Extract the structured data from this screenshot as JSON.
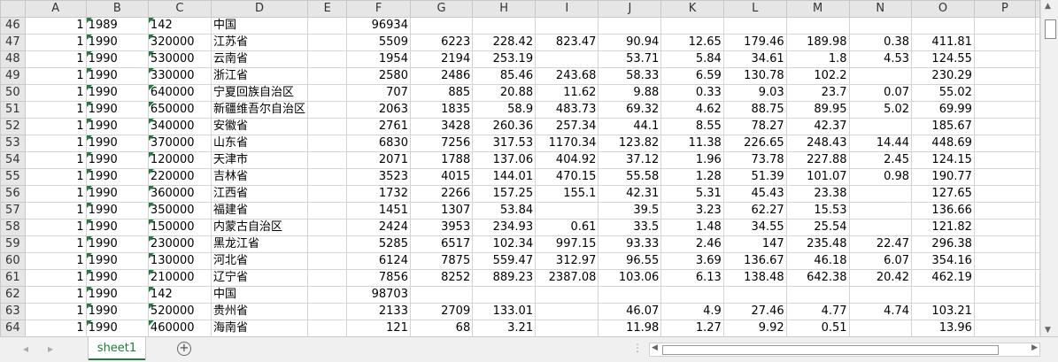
{
  "columns": [
    "A",
    "B",
    "C",
    "D",
    "E",
    "F",
    "G",
    "H",
    "I",
    "J",
    "K",
    "L",
    "M",
    "N",
    "O",
    "P"
  ],
  "rows": [
    {
      "n": "46",
      "A": "1",
      "B": "1989",
      "C": "142",
      "D": "中国",
      "E": "",
      "F": "96934",
      "G": "",
      "H": "",
      "I": "",
      "J": "",
      "K": "",
      "L": "",
      "M": "",
      "N": "",
      "O": "",
      "P": ""
    },
    {
      "n": "47",
      "A": "1",
      "B": "1990",
      "C": "320000",
      "D": "江苏省",
      "E": "",
      "F": "5509",
      "G": "6223",
      "H": "228.42",
      "I": "823.47",
      "J": "90.94",
      "K": "12.65",
      "L": "179.46",
      "M": "189.98",
      "N": "0.38",
      "O": "411.81",
      "P": ""
    },
    {
      "n": "48",
      "A": "1",
      "B": "1990",
      "C": "530000",
      "D": "云南省",
      "E": "",
      "F": "1954",
      "G": "2194",
      "H": "253.19",
      "I": "",
      "J": "53.71",
      "K": "5.84",
      "L": "34.61",
      "M": "1.8",
      "N": "4.53",
      "O": "124.55",
      "P": ""
    },
    {
      "n": "49",
      "A": "1",
      "B": "1990",
      "C": "330000",
      "D": "浙江省",
      "E": "",
      "F": "2580",
      "G": "2486",
      "H": "85.46",
      "I": "243.68",
      "J": "58.33",
      "K": "6.59",
      "L": "130.78",
      "M": "102.2",
      "N": "",
      "O": "230.29",
      "P": ""
    },
    {
      "n": "50",
      "A": "1",
      "B": "1990",
      "C": "640000",
      "D": "宁夏回族自治区",
      "E": "",
      "F": "707",
      "G": "885",
      "H": "20.88",
      "I": "11.62",
      "J": "9.88",
      "K": "0.33",
      "L": "9.03",
      "M": "23.7",
      "N": "0.07",
      "O": "55.02",
      "P": ""
    },
    {
      "n": "51",
      "A": "1",
      "B": "1990",
      "C": "650000",
      "D": "新疆维吾尔自治区",
      "E": "",
      "F": "2063",
      "G": "1835",
      "H": "58.9",
      "I": "483.73",
      "J": "69.32",
      "K": "4.62",
      "L": "88.75",
      "M": "89.95",
      "N": "5.02",
      "O": "69.99",
      "P": ""
    },
    {
      "n": "52",
      "A": "1",
      "B": "1990",
      "C": "340000",
      "D": "安徽省",
      "E": "",
      "F": "2761",
      "G": "3428",
      "H": "260.36",
      "I": "257.34",
      "J": "44.1",
      "K": "8.55",
      "L": "78.27",
      "M": "42.37",
      "N": "",
      "O": "185.67",
      "P": ""
    },
    {
      "n": "53",
      "A": "1",
      "B": "1990",
      "C": "370000",
      "D": "山东省",
      "E": "",
      "F": "6830",
      "G": "7256",
      "H": "317.53",
      "I": "1170.34",
      "J": "123.82",
      "K": "11.38",
      "L": "226.65",
      "M": "248.43",
      "N": "14.44",
      "O": "448.69",
      "P": ""
    },
    {
      "n": "54",
      "A": "1",
      "B": "1990",
      "C": "120000",
      "D": "天津市",
      "E": "",
      "F": "2071",
      "G": "1788",
      "H": "137.06",
      "I": "404.92",
      "J": "37.12",
      "K": "1.96",
      "L": "73.78",
      "M": "227.88",
      "N": "2.45",
      "O": "124.15",
      "P": ""
    },
    {
      "n": "55",
      "A": "1",
      "B": "1990",
      "C": "220000",
      "D": "吉林省",
      "E": "",
      "F": "3523",
      "G": "4015",
      "H": "144.01",
      "I": "470.15",
      "J": "55.58",
      "K": "1.28",
      "L": "51.39",
      "M": "101.07",
      "N": "0.98",
      "O": "190.77",
      "P": ""
    },
    {
      "n": "56",
      "A": "1",
      "B": "1990",
      "C": "360000",
      "D": "江西省",
      "E": "",
      "F": "1732",
      "G": "2266",
      "H": "157.25",
      "I": "155.1",
      "J": "42.31",
      "K": "5.31",
      "L": "45.43",
      "M": "23.38",
      "N": "",
      "O": "127.65",
      "P": ""
    },
    {
      "n": "57",
      "A": "1",
      "B": "1990",
      "C": "350000",
      "D": "福建省",
      "E": "",
      "F": "1451",
      "G": "1307",
      "H": "53.84",
      "I": "",
      "J": "39.5",
      "K": "3.23",
      "L": "62.27",
      "M": "15.53",
      "N": "",
      "O": "136.66",
      "P": ""
    },
    {
      "n": "58",
      "A": "1",
      "B": "1990",
      "C": "150000",
      "D": "内蒙古自治区",
      "E": "",
      "F": "2424",
      "G": "3953",
      "H": "234.93",
      "I": "0.61",
      "J": "33.5",
      "K": "1.48",
      "L": "34.55",
      "M": "25.54",
      "N": "",
      "O": "121.82",
      "P": ""
    },
    {
      "n": "59",
      "A": "1",
      "B": "1990",
      "C": "230000",
      "D": "黑龙江省",
      "E": "",
      "F": "5285",
      "G": "6517",
      "H": "102.34",
      "I": "997.15",
      "J": "93.33",
      "K": "2.46",
      "L": "147",
      "M": "235.48",
      "N": "22.47",
      "O": "296.38",
      "P": ""
    },
    {
      "n": "60",
      "A": "1",
      "B": "1990",
      "C": "130000",
      "D": "河北省",
      "E": "",
      "F": "6124",
      "G": "7875",
      "H": "559.47",
      "I": "312.97",
      "J": "96.55",
      "K": "3.69",
      "L": "136.67",
      "M": "46.18",
      "N": "6.07",
      "O": "354.16",
      "P": ""
    },
    {
      "n": "61",
      "A": "1",
      "B": "1990",
      "C": "210000",
      "D": "辽宁省",
      "E": "",
      "F": "7856",
      "G": "8252",
      "H": "889.23",
      "I": "2387.08",
      "J": "103.06",
      "K": "6.13",
      "L": "138.48",
      "M": "642.38",
      "N": "20.42",
      "O": "462.19",
      "P": ""
    },
    {
      "n": "62",
      "A": "1",
      "B": "1990",
      "C": "142",
      "D": "中国",
      "E": "",
      "F": "98703",
      "G": "",
      "H": "",
      "I": "",
      "J": "",
      "K": "",
      "L": "",
      "M": "",
      "N": "",
      "O": "",
      "P": ""
    },
    {
      "n": "63",
      "A": "1",
      "B": "1990",
      "C": "520000",
      "D": "贵州省",
      "E": "",
      "F": "2133",
      "G": "2709",
      "H": "133.01",
      "I": "",
      "J": "46.07",
      "K": "4.9",
      "L": "27.46",
      "M": "4.77",
      "N": "4.74",
      "O": "103.21",
      "P": ""
    },
    {
      "n": "64",
      "A": "1",
      "B": "1990",
      "C": "460000",
      "D": "海南省",
      "E": "",
      "F": "121",
      "G": "68",
      "H": "3.21",
      "I": "",
      "J": "11.98",
      "K": "1.27",
      "L": "9.92",
      "M": "0.51",
      "N": "",
      "O": "13.96",
      "P": ""
    }
  ],
  "sheet_tab": "sheet1",
  "accent_color": "#1e7d3a",
  "icons": {
    "add_sheet": "plus-circle-icon",
    "scroll_left": "triangle-left-icon",
    "scroll_right": "triangle-right-icon",
    "scroll_up": "triangle-up-icon",
    "scroll_down": "triangle-down-icon"
  }
}
